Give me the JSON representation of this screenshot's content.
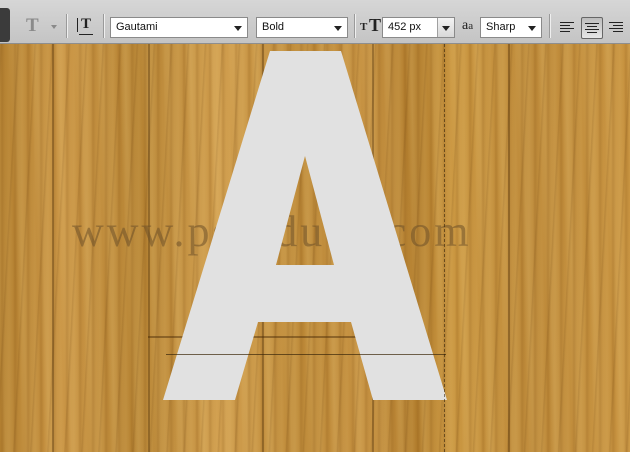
{
  "options_bar": {
    "font_family": "Gautami",
    "font_style": "Bold",
    "font_size": "452 px",
    "anti_alias": "Sharp",
    "aa_glyph_big": "a",
    "aa_glyph_small": "a",
    "tool_glyph": "T",
    "size_glyph": "T",
    "alignment_selected": "center",
    "icons": [
      "type-tool-icon",
      "text-orientation-icon",
      "font-size-icon",
      "anti-alias-icon",
      "align-left-icon",
      "align-center-icon",
      "align-right-icon"
    ]
  },
  "canvas": {
    "letter": "A",
    "watermark": "www.psd-dude.com",
    "letter_color": "#e1e1e1"
  }
}
